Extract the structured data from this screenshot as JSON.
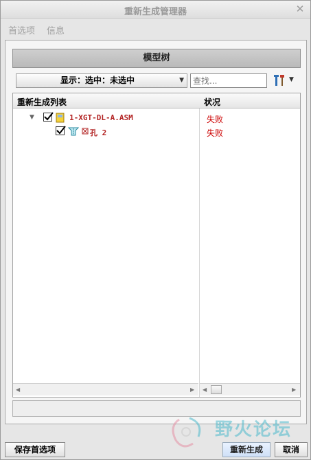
{
  "window": {
    "title": "重新生成管理器",
    "close_icon": "close-icon"
  },
  "menu": {
    "items": [
      "首选项",
      "信息"
    ]
  },
  "model_tree": {
    "title": "模型树",
    "show_dropdown": "显示：选中：未选中",
    "search_placeholder": "查找...",
    "columns": [
      "重新生成列表",
      "状况"
    ],
    "rows": [
      {
        "label": "1-XGT-DL-A.ASM",
        "status": "失败",
        "checked": true,
        "icon": "assembly-icon"
      },
      {
        "label": "孔 2",
        "status": "失败",
        "checked": true,
        "icon": "hole-feature-icon"
      }
    ]
  },
  "buttons": {
    "save_prefs": "保存首选项",
    "regenerate": "重新生成",
    "cancel": "取消"
  },
  "watermark": {
    "text": "野火论坛"
  },
  "colors": {
    "status_failed": "#cc0000",
    "item_label": "#b22222",
    "watermark": "#3fb5c9"
  }
}
